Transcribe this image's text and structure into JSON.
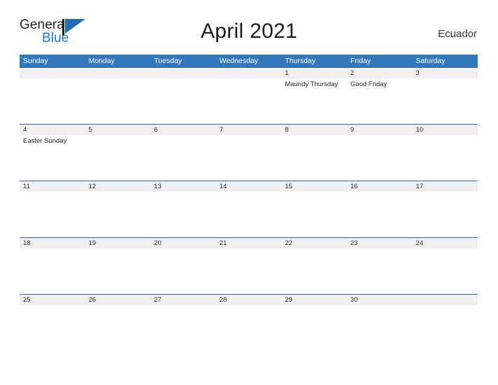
{
  "brand": {
    "name_part1": "General",
    "name_part2": "Blue",
    "flag_icon": "blue-triangle-flag",
    "accent_color": "#1f7ac6"
  },
  "header": {
    "title": "April 2021",
    "country": "Ecuador",
    "header_bg_color": "#3278bd",
    "row_rule_color": "#2f6aa8",
    "number_band_color": "#f0f0f0"
  },
  "weekdays": [
    "Sunday",
    "Monday",
    "Tuesday",
    "Wednesday",
    "Thursday",
    "Friday",
    "Saturday"
  ],
  "weeks": [
    {
      "days": [
        {
          "number": "",
          "event": ""
        },
        {
          "number": "",
          "event": ""
        },
        {
          "number": "",
          "event": ""
        },
        {
          "number": "",
          "event": ""
        },
        {
          "number": "1",
          "event": "Maundy Thursday"
        },
        {
          "number": "2",
          "event": "Good Friday"
        },
        {
          "number": "3",
          "event": ""
        }
      ]
    },
    {
      "days": [
        {
          "number": "4",
          "event": "Easter Sunday"
        },
        {
          "number": "5",
          "event": ""
        },
        {
          "number": "6",
          "event": ""
        },
        {
          "number": "7",
          "event": ""
        },
        {
          "number": "8",
          "event": ""
        },
        {
          "number": "9",
          "event": ""
        },
        {
          "number": "10",
          "event": ""
        }
      ]
    },
    {
      "days": [
        {
          "number": "11",
          "event": ""
        },
        {
          "number": "12",
          "event": ""
        },
        {
          "number": "13",
          "event": ""
        },
        {
          "number": "14",
          "event": ""
        },
        {
          "number": "15",
          "event": ""
        },
        {
          "number": "16",
          "event": ""
        },
        {
          "number": "17",
          "event": ""
        }
      ]
    },
    {
      "days": [
        {
          "number": "18",
          "event": ""
        },
        {
          "number": "19",
          "event": ""
        },
        {
          "number": "20",
          "event": ""
        },
        {
          "number": "21",
          "event": ""
        },
        {
          "number": "22",
          "event": ""
        },
        {
          "number": "23",
          "event": ""
        },
        {
          "number": "24",
          "event": ""
        }
      ]
    },
    {
      "days": [
        {
          "number": "25",
          "event": ""
        },
        {
          "number": "26",
          "event": ""
        },
        {
          "number": "27",
          "event": ""
        },
        {
          "number": "28",
          "event": ""
        },
        {
          "number": "29",
          "event": ""
        },
        {
          "number": "30",
          "event": ""
        },
        {
          "number": "",
          "event": ""
        }
      ]
    }
  ]
}
